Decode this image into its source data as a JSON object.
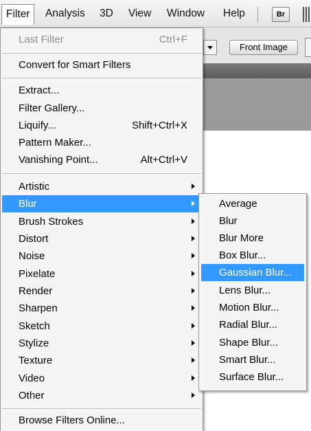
{
  "menubar": {
    "items": [
      "Filter",
      "Analysis",
      "3D",
      "View",
      "Window",
      "Help"
    ],
    "bridge_button": "Br"
  },
  "optionsbar": {
    "front_image_button": "Front Image"
  },
  "filter_menu": {
    "last_filter": {
      "label": "Last Filter",
      "shortcut": "Ctrl+F",
      "enabled": false
    },
    "convert_smart": "Convert for Smart Filters",
    "extract": "Extract...",
    "filter_gallery": "Filter Gallery...",
    "liquify": {
      "label": "Liquify...",
      "shortcut": "Shift+Ctrl+X"
    },
    "pattern_maker": "Pattern Maker...",
    "vanishing_point": {
      "label": "Vanishing Point...",
      "shortcut": "Alt+Ctrl+V"
    },
    "submenus": [
      "Artistic",
      "Blur",
      "Brush Strokes",
      "Distort",
      "Noise",
      "Pixelate",
      "Render",
      "Sharpen",
      "Sketch",
      "Stylize",
      "Texture",
      "Video",
      "Other"
    ],
    "highlighted_submenu": "Blur",
    "browse_online": "Browse Filters Online..."
  },
  "blur_menu": {
    "items": [
      "Average",
      "Blur",
      "Blur More",
      "Box Blur...",
      "Gaussian Blur...",
      "Lens Blur...",
      "Motion Blur...",
      "Radial Blur...",
      "Shape Blur...",
      "Smart Blur...",
      "Surface Blur..."
    ],
    "highlighted": "Gaussian Blur..."
  },
  "colors": {
    "highlight": "#3399ff",
    "menu_bg": "#f5f5f5",
    "disabled_text": "#8d8d8d"
  }
}
